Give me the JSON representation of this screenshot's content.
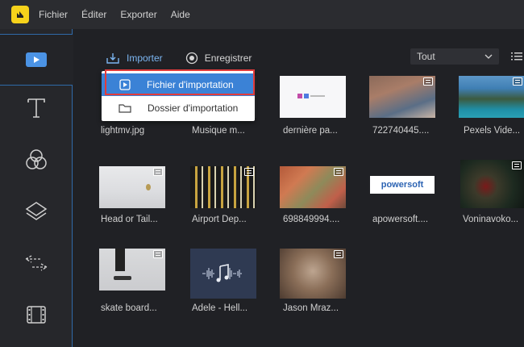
{
  "menubar": {
    "items": [
      "Fichier",
      "Éditer",
      "Exporter",
      "Aide"
    ]
  },
  "sidebar": {
    "items": [
      {
        "name": "media",
        "active": true
      },
      {
        "name": "text",
        "active": false
      },
      {
        "name": "filters",
        "active": false
      },
      {
        "name": "overlays",
        "active": false
      },
      {
        "name": "transitions",
        "active": false
      },
      {
        "name": "elements",
        "active": false
      }
    ]
  },
  "toolbar": {
    "import_label": "Importer",
    "record_label": "Enregistrer",
    "filter_value": "Tout"
  },
  "dropdown": {
    "file_import_label": "Fichier d'importation",
    "folder_import_label": "Dossier d'importation"
  },
  "media": [
    {
      "name": "lightmv.jpg",
      "video": false
    },
    {
      "name": "Musique m...",
      "video": false
    },
    {
      "name": "dernière pa...",
      "video": false
    },
    {
      "name": "722740445....",
      "video": true
    },
    {
      "name": "Pexels Vide...",
      "video": true
    },
    {
      "name": "Head or Tail...",
      "video": true
    },
    {
      "name": "Airport Dep...",
      "video": true
    },
    {
      "name": "698849994....",
      "video": true
    },
    {
      "name": "apowersoft....",
      "video": false,
      "logo_text": "powersoft"
    },
    {
      "name": "Voninavoko...",
      "video": true
    },
    {
      "name": "skate board...",
      "video": true
    },
    {
      "name": "Adele - Hell...",
      "video": false
    },
    {
      "name": "Jason Mraz...",
      "video": true
    }
  ],
  "colors": {
    "accent": "#3b82d6",
    "highlight": "#e23b3b",
    "logo": "#f6d21b"
  }
}
